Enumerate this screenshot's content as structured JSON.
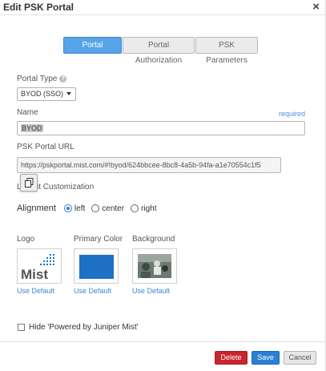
{
  "dialog": {
    "title": "Edit PSK Portal",
    "close_glyph": "×"
  },
  "tabs": [
    {
      "label": "Portal Settings",
      "active": true
    },
    {
      "label": "Portal Authorization",
      "active": false
    },
    {
      "label": "PSK Parameters",
      "active": false
    }
  ],
  "portal_type": {
    "label": "Portal Type",
    "help_glyph": "?",
    "value": "BYOD (SSO)"
  },
  "name": {
    "label": "Name",
    "required_text": "required",
    "value": "BYOD"
  },
  "psk_portal_url": {
    "label": "PSK Portal URL",
    "value": "https://pskportal.mist.com/#!byod/624bbcee-8bc8-4a5b-94fa-a1e70554c1f5"
  },
  "layout": {
    "label": "Layout Customization"
  },
  "alignment": {
    "label": "Alignment",
    "options": [
      "left",
      "center",
      "right"
    ],
    "selected": "left"
  },
  "images": {
    "logo_label": "Logo",
    "primary_color_label": "Primary Color",
    "background_label": "Background",
    "primary_color": "#1e70c4",
    "logo_text": "Mist",
    "use_default": "Use Default"
  },
  "hide_powered": {
    "label": "Hide 'Powered by Juniper Mist'",
    "checked": false
  },
  "footer": {
    "delete_label": "Delete",
    "save_label": "Save",
    "cancel_label": "Cancel"
  },
  "colors": {
    "accent": "#2b7fd4",
    "danger": "#c9252e",
    "link": "#3b86d6"
  }
}
